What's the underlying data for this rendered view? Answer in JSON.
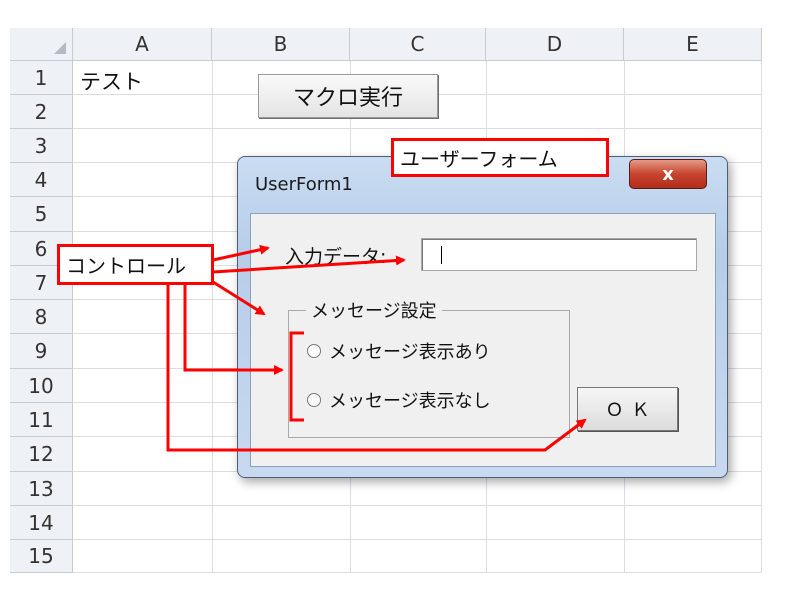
{
  "sheet": {
    "columns": [
      "A",
      "B",
      "C",
      "D",
      "E"
    ],
    "rows": [
      "1",
      "2",
      "3",
      "4",
      "5",
      "6",
      "7",
      "8",
      "9",
      "10",
      "11",
      "12",
      "13",
      "14",
      "15"
    ],
    "cells": {
      "A1": "テスト"
    }
  },
  "sheet_button": {
    "label": "マクロ実行"
  },
  "dialog": {
    "title": "UserForm1",
    "close_label": "x",
    "input_label": "入力データ:",
    "input_value": "",
    "frame_title": "メッセージ設定",
    "radio_options": [
      "メッセージ表示あり",
      "メッセージ表示なし"
    ],
    "ok_label": "ＯＫ"
  },
  "annotations": {
    "userform_callout": "ユーザーフォーム",
    "controls_callout": "コントロール",
    "color": "#ff0000"
  }
}
